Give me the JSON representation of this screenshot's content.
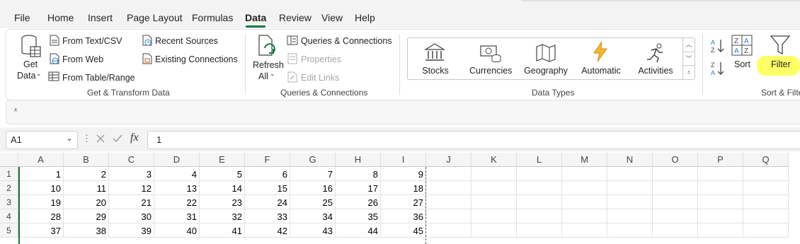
{
  "menu": {
    "tabs": [
      {
        "label": "File",
        "active": false
      },
      {
        "label": "Home",
        "active": false
      },
      {
        "label": "Insert",
        "active": false
      },
      {
        "label": "Page Layout",
        "active": false
      },
      {
        "label": "Formulas",
        "active": false
      },
      {
        "label": "Data",
        "active": true
      },
      {
        "label": "Review",
        "active": false
      },
      {
        "label": "View",
        "active": false
      },
      {
        "label": "Help",
        "active": false
      }
    ],
    "accent_color": "#107c41"
  },
  "ribbon": {
    "get_transform": {
      "get_data_line1": "Get",
      "get_data_line2": "Data",
      "from_text_csv": "From Text/CSV",
      "from_web": "From Web",
      "from_table_range": "From Table/Range",
      "recent_sources": "Recent Sources",
      "existing_connections": "Existing Connections",
      "group_label": "Get & Transform Data"
    },
    "queries": {
      "refresh_line1": "Refresh",
      "refresh_line2": "All",
      "queries_connections": "Queries & Connections",
      "properties": "Properties",
      "edit_links": "Edit Links",
      "group_label": "Queries & Connections"
    },
    "data_types": {
      "items": [
        {
          "label": "Stocks",
          "icon": "bank-icon"
        },
        {
          "label": "Currencies",
          "icon": "currency-icon"
        },
        {
          "label": "Geography",
          "icon": "map-icon"
        },
        {
          "label": "Automatic",
          "icon": "lightning-icon"
        },
        {
          "label": "Activities",
          "icon": "running-icon"
        }
      ],
      "group_label": "Data Types"
    },
    "sort_filter": {
      "sort": "Sort",
      "filter": "Filter",
      "group_label": "Sort & Filte",
      "highlight_color": "#ffff66"
    }
  },
  "formula_bar": {
    "name_box": "A1",
    "fx": "fx",
    "value": "1"
  },
  "sheet": {
    "columns": [
      "A",
      "B",
      "C",
      "D",
      "E",
      "F",
      "G",
      "H",
      "I",
      "J",
      "K",
      "L",
      "M",
      "N",
      "O",
      "P",
      "Q"
    ],
    "rows": [
      {
        "num": "1",
        "cells": [
          "1",
          "2",
          "3",
          "4",
          "5",
          "6",
          "7",
          "8",
          "9"
        ]
      },
      {
        "num": "2",
        "cells": [
          "10",
          "11",
          "12",
          "13",
          "14",
          "15",
          "16",
          "17",
          "18"
        ]
      },
      {
        "num": "3",
        "cells": [
          "19",
          "20",
          "21",
          "22",
          "23",
          "24",
          "25",
          "26",
          "27"
        ]
      },
      {
        "num": "4",
        "cells": [
          "28",
          "29",
          "30",
          "31",
          "32",
          "33",
          "34",
          "35",
          "36"
        ]
      },
      {
        "num": "5",
        "cells": [
          "37",
          "38",
          "39",
          "40",
          "41",
          "42",
          "43",
          "44",
          "45"
        ]
      }
    ]
  }
}
